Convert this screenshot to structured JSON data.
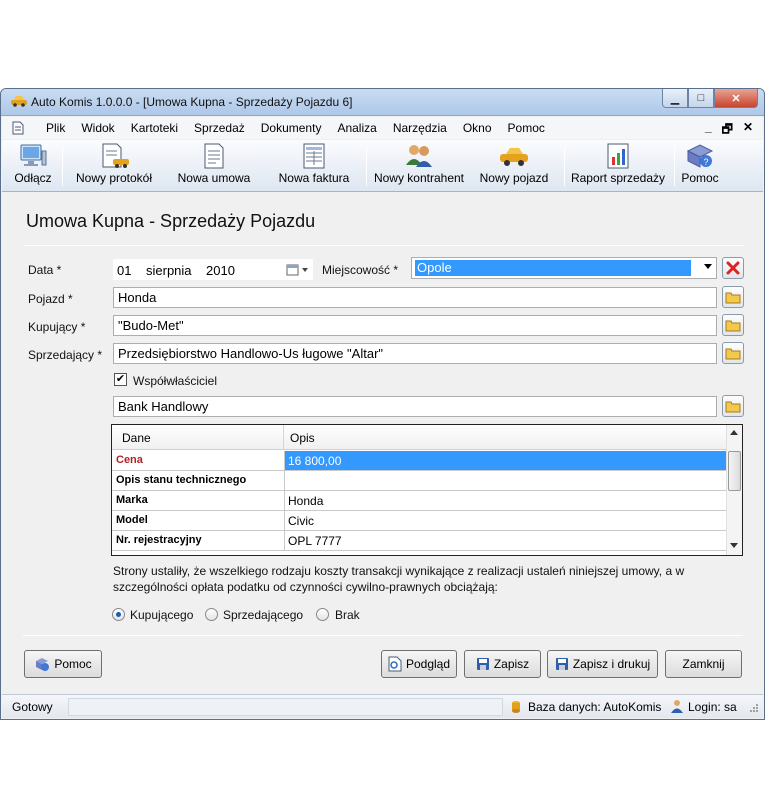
{
  "window": {
    "title": "Auto Komis 1.0.0.0 - [Umowa Kupna - Sprzedaży Pojazdu 6]",
    "minimize": "▁",
    "maximize": "□",
    "close": "✕"
  },
  "menu": {
    "items": [
      "Plik",
      "Widok",
      "Kartoteki",
      "Sprzedaż",
      "Dokumenty",
      "Analiza",
      "Narzędzia",
      "Okno",
      "Pomoc"
    ],
    "mdi_minimize": "_",
    "mdi_restore": "🗗",
    "mdi_close": "✕"
  },
  "toolbar": {
    "disconnect": "Odłącz",
    "new_protocol": "Nowy protokół",
    "new_contract": "Nowa umowa",
    "new_invoice": "Nowa faktura",
    "new_contractor": "Nowy kontrahent",
    "new_vehicle": "Nowy pojazd",
    "sales_report": "Raport sprzedaży",
    "help": "Pomoc"
  },
  "form": {
    "title": "Umowa Kupna - Sprzedaży Pojazdu",
    "date_label": "Data *",
    "date_day": "01",
    "date_month": "sierpnia",
    "date_year": "2010",
    "city_label": "Miejscowość *",
    "city_value": "Opole",
    "vehicle_label": "Pojazd *",
    "vehicle_value": "Honda",
    "buyer_label": "Kupujący *",
    "buyer_value": "\"Budo-Met\"",
    "seller_label": "Sprzedający *",
    "seller_value": "Przedsiębiorstwo Handlowo-Us ługowe \"Altar\"",
    "coowner_label": "Współwłaściciel",
    "coowner_checked": true,
    "coowner_value": "Bank Handlowy"
  },
  "grid": {
    "headers": [
      "Dane",
      "Opis"
    ],
    "rows": [
      {
        "name": "Cena",
        "value": "16 800,00",
        "selected": true
      },
      {
        "name": "Opis stanu technicznego",
        "value": ""
      },
      {
        "name": "Marka",
        "value": "Honda"
      },
      {
        "name": "Model",
        "value": "Civic"
      },
      {
        "name": "Nr. rejestracyjny",
        "value": "OPL 7777"
      }
    ],
    "accent_color": "#b22222"
  },
  "costs": {
    "text_line1": "Strony ustaliły, że wszelkiego rodzaju koszty transakcji wynikające z realizacji ustaleń niniejszej umowy, a w",
    "text_line2": "szczególności opłata podatku od czynności cywilno-prawnych obciążają:",
    "options": [
      "Kupującego",
      "Sprzedającego",
      "Brak"
    ],
    "selected": "Kupującego"
  },
  "buttons": {
    "help": "Pomoc",
    "preview": "Podgląd",
    "save": "Zapisz",
    "save_print": "Zapisz i drukuj",
    "close": "Zamknij"
  },
  "status": {
    "ready": "Gotowy",
    "database": "Baza danych: AutoKomis",
    "login": "Login: sa"
  }
}
